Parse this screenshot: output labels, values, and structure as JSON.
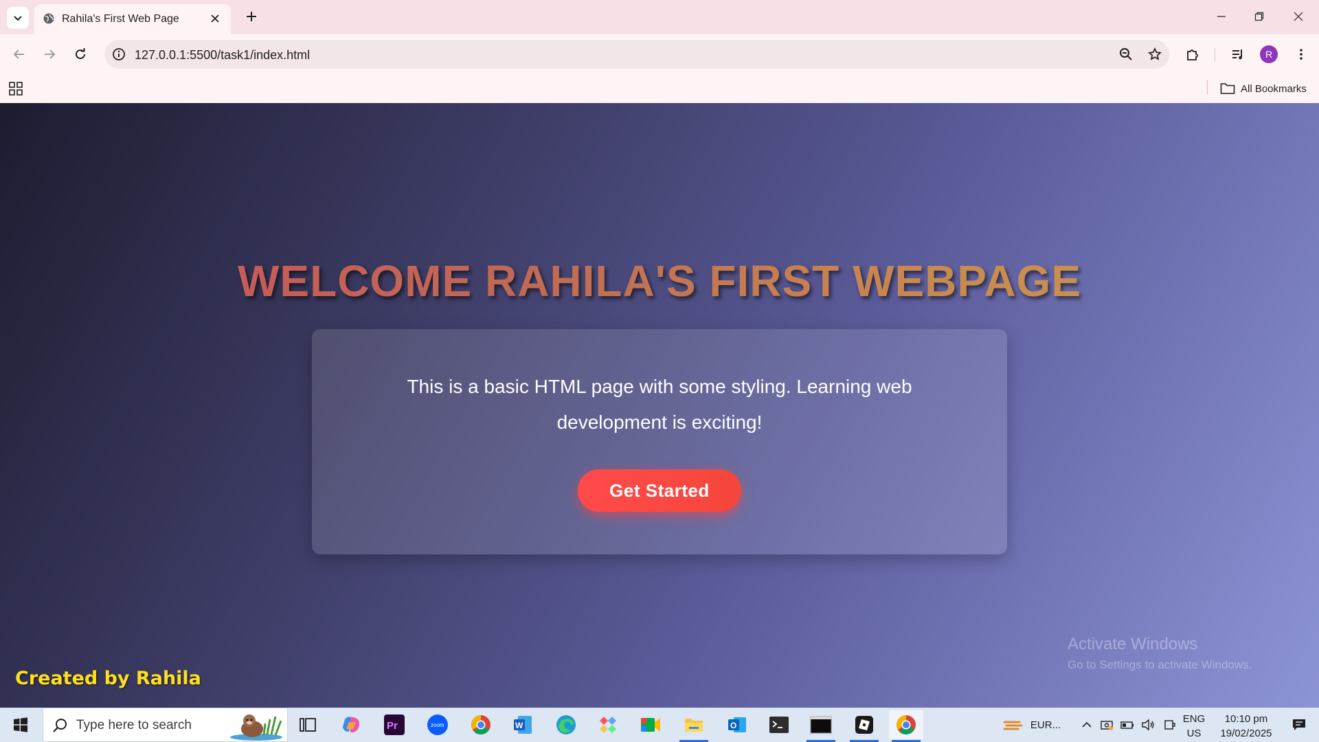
{
  "browser": {
    "tab": {
      "title": "Rahila's First Web Page"
    },
    "url": "127.0.0.1:5500/task1/index.html",
    "profile_initial": "R",
    "bookmarks": {
      "all_label": "All Bookmarks"
    }
  },
  "page": {
    "heading": "WELCOME RAHILA'S FIRST WEBPAGE",
    "intro": "This is a basic HTML page with some styling. Learning web development is exciting!",
    "cta_label": "Get Started",
    "credit": "Created by Rahila",
    "watermark": {
      "title": "Activate Windows",
      "subtitle": "Go to Settings to activate Windows."
    }
  },
  "taskbar": {
    "search_placeholder": "Type here to search",
    "apps": [
      "Task View",
      "Copilot",
      "Premiere Pro",
      "Zoom",
      "Google Chrome",
      "Microsoft Word",
      "Microsoft Edge",
      "Git Extensions",
      "Google Meet",
      "File Explorer",
      "Outlook",
      "Terminal",
      "Command Prompt",
      "Roblox",
      "Google Chrome"
    ],
    "weather": "EUR...",
    "lang_line1": "ENG",
    "lang_line2": "US",
    "time": "10:10 pm",
    "date": "19/02/2025"
  },
  "colors": {
    "accent_button": "#ff4b4b",
    "credit_yellow": "#ffe01a",
    "avatar": "#8e37b8",
    "tabstrip": "#f7e1e6"
  }
}
